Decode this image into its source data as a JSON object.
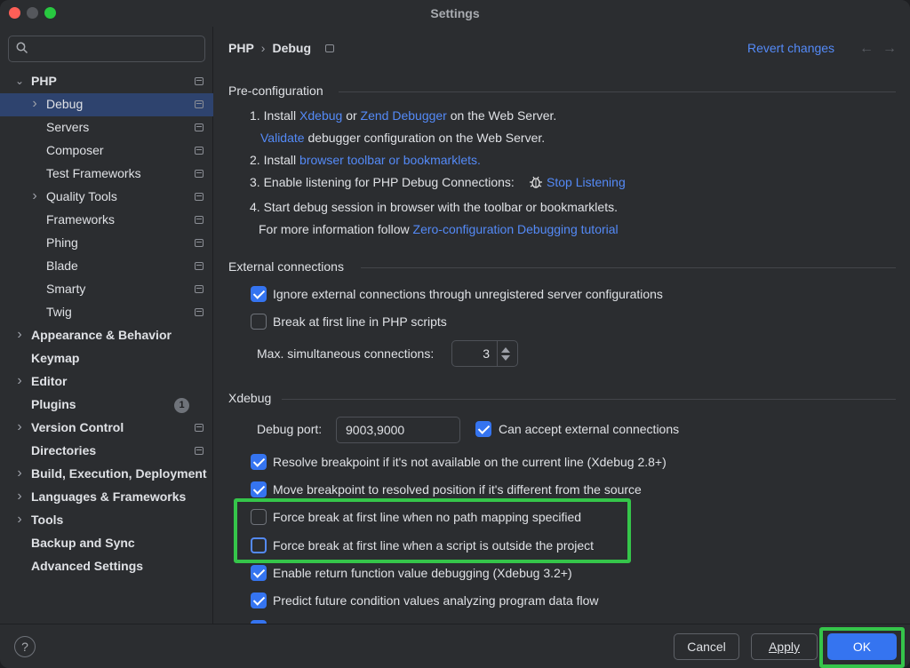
{
  "window": {
    "title": "Settings"
  },
  "search": {
    "placeholder": ""
  },
  "sidebar": {
    "items": [
      {
        "label": "PHP",
        "level": 0,
        "expanded": true,
        "bold": true
      },
      {
        "label": "Debug",
        "level": 1,
        "chevron": true,
        "selected": true
      },
      {
        "label": "Servers",
        "level": 1
      },
      {
        "label": "Composer",
        "level": 1
      },
      {
        "label": "Test Frameworks",
        "level": 1
      },
      {
        "label": "Quality Tools",
        "level": 1,
        "chevron": true
      },
      {
        "label": "Frameworks",
        "level": 1
      },
      {
        "label": "Phing",
        "level": 1
      },
      {
        "label": "Blade",
        "level": 1
      },
      {
        "label": "Smarty",
        "level": 1
      },
      {
        "label": "Twig",
        "level": 1
      },
      {
        "label": "Appearance & Behavior",
        "level": 0,
        "chevron": true,
        "bold": true
      },
      {
        "label": "Keymap",
        "level": 0,
        "bold": true
      },
      {
        "label": "Editor",
        "level": 0,
        "chevron": true,
        "bold": true
      },
      {
        "label": "Plugins",
        "level": 0,
        "bold": true,
        "badge": "1"
      },
      {
        "label": "Version Control",
        "level": 0,
        "chevron": true,
        "bold": true
      },
      {
        "label": "Directories",
        "level": 0,
        "bold": true
      },
      {
        "label": "Build, Execution, Deployment",
        "level": 0,
        "chevron": true,
        "bold": true
      },
      {
        "label": "Languages & Frameworks",
        "level": 0,
        "chevron": true,
        "bold": true
      },
      {
        "label": "Tools",
        "level": 0,
        "chevron": true,
        "bold": true
      },
      {
        "label": "Backup and Sync",
        "level": 0,
        "bold": true
      },
      {
        "label": "Advanced Settings",
        "level": 0,
        "bold": true
      }
    ]
  },
  "header": {
    "breadcrumb_root": "PHP",
    "breadcrumb_sep": "›",
    "breadcrumb_current": "Debug",
    "revert": "Revert changes",
    "back": "←",
    "forward": "→"
  },
  "preconfig": {
    "title": "Pre-configuration",
    "step1_prefix": "1. Install ",
    "xdebug": "Xdebug",
    "or": " or ",
    "zend": "Zend Debugger",
    "step1_suffix": " on the Web Server.",
    "validate": "Validate",
    "validate_suffix": " debugger configuration on the Web Server.",
    "step2_prefix": "2. Install ",
    "toolbar_link": "browser toolbar or bookmarklets.",
    "step3": "3. Enable listening for PHP Debug Connections:",
    "stop_listening": "Stop Listening",
    "step4": "4. Start debug session in browser with the toolbar or bookmarklets.",
    "more_prefix": "For more information follow ",
    "tutorial": "Zero-configuration Debugging tutorial"
  },
  "external": {
    "title": "External connections",
    "ignore": {
      "label": "Ignore external connections through unregistered server configurations",
      "checked": true
    },
    "break_first": {
      "label": "Break at first line in PHP scripts",
      "checked": false
    },
    "max_label": "Max. simultaneous connections:",
    "max_value": "3"
  },
  "xdebug": {
    "title": "Xdebug",
    "port_label": "Debug port:",
    "port_value": "9003,9000",
    "accept_external": {
      "label": "Can accept external connections",
      "checked": true
    },
    "resolve_breakpoint": {
      "label": "Resolve breakpoint if it's not available on the current line (Xdebug 2.8+)",
      "checked": true
    },
    "move_breakpoint": {
      "label": "Move breakpoint to resolved position if it's different from the source",
      "checked": true
    },
    "force_no_mapping": {
      "label": "Force break at first line when no path mapping specified",
      "checked": false
    },
    "force_outside": {
      "label": "Force break at first line when a script is outside the project",
      "checked": false
    },
    "return_value": {
      "label": "Enable return function value debugging (Xdebug 3.2+)",
      "checked": true
    },
    "predict": {
      "label": "Predict future condition values analyzing program data flow",
      "checked": true
    }
  },
  "footer": {
    "help": "?",
    "cancel": "Cancel",
    "apply": "Apply",
    "ok": "OK"
  },
  "colors": {
    "accent": "#3574f0",
    "link": "#548af7",
    "highlight": "#35c54a",
    "background": "#2b2d30",
    "selected_row": "#2e436e"
  }
}
